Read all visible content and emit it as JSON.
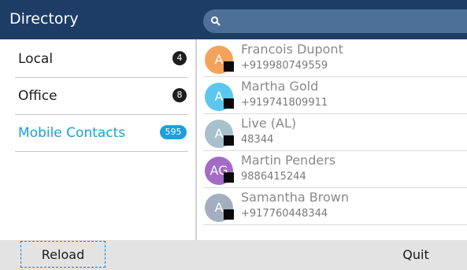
{
  "header": {
    "title": "Directory",
    "search": {
      "value": "",
      "icon": "search-icon"
    }
  },
  "categories": [
    {
      "label": "Local",
      "count": "4",
      "active": false
    },
    {
      "label": "Office",
      "count": "8",
      "active": false
    },
    {
      "label": "Mobile Contacts",
      "count": "595",
      "active": true
    }
  ],
  "contacts": [
    {
      "initials": "A",
      "name": "Francois Dupont",
      "phone": "+919980749559",
      "avatar_color": "#f5a35c",
      "status_icon": "presence-square-icon"
    },
    {
      "initials": "A",
      "name": "Martha Gold",
      "phone": "+919741809911",
      "avatar_color": "#5cc7ee",
      "status_icon": "presence-square-icon"
    },
    {
      "initials": "A",
      "name": "Live (AL)",
      "phone": "48344",
      "avatar_color": "#a8bfcc",
      "status_icon": "presence-square-icon"
    },
    {
      "initials": "AG",
      "name": "Martin Penders",
      "phone": "9886415244",
      "avatar_color": "#a26bc6",
      "status_icon": "presence-square-icon"
    },
    {
      "initials": "A",
      "name": "Samantha Brown",
      "phone": "+917760448344",
      "avatar_color": "#a3afbf",
      "status_icon": "presence-square-icon"
    }
  ],
  "softkeys": {
    "reload": "Reload",
    "quit": "Quit"
  },
  "colors": {
    "header_bg": "#1d3d67",
    "search_bg": "#4e6f97",
    "accent": "#1aa0dc",
    "footer_bg": "#e3e3e3"
  }
}
